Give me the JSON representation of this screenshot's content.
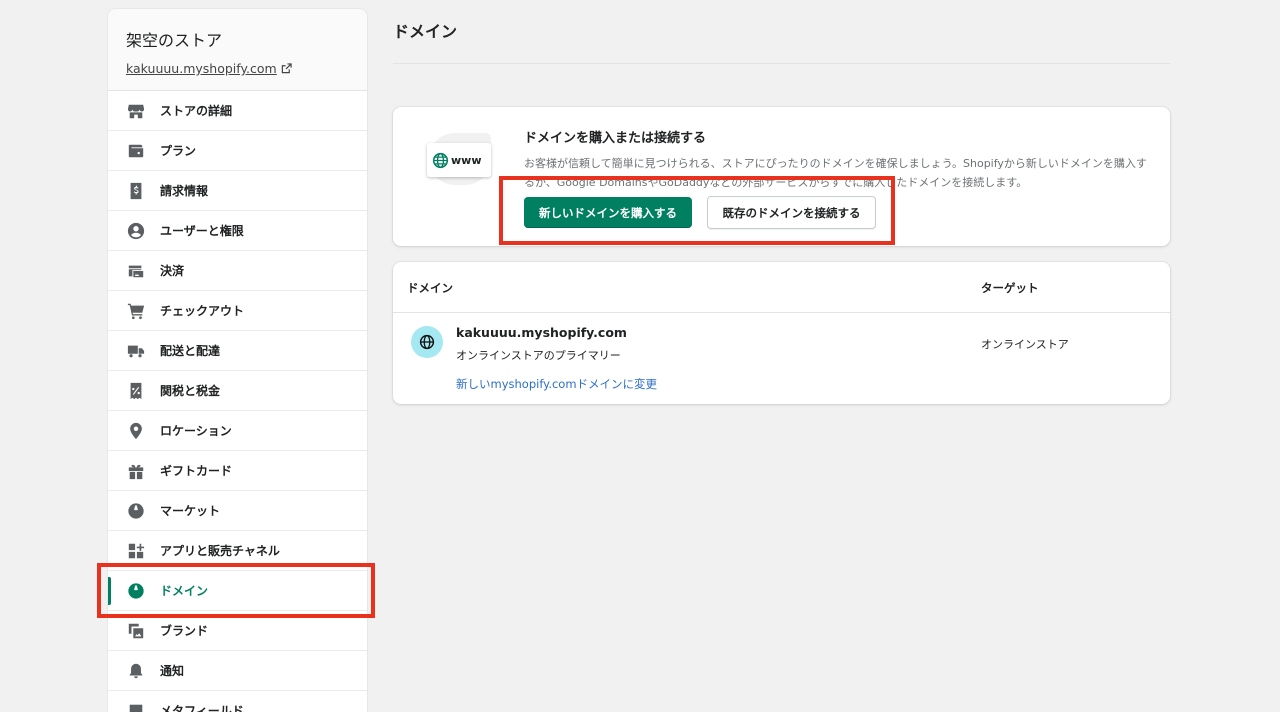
{
  "sidebar": {
    "store_name": "架空のストア",
    "store_url": "kakuuuu.myshopify.com",
    "items": [
      {
        "label": "ストアの詳細",
        "icon": "store-icon"
      },
      {
        "label": "プラン",
        "icon": "wallet-icon"
      },
      {
        "label": "請求情報",
        "icon": "billing-icon"
      },
      {
        "label": "ユーザーと権限",
        "icon": "user-icon"
      },
      {
        "label": "決済",
        "icon": "payment-card-icon"
      },
      {
        "label": "チェックアウト",
        "icon": "cart-icon"
      },
      {
        "label": "配送と配達",
        "icon": "truck-icon"
      },
      {
        "label": "関税と税金",
        "icon": "tax-receipt-icon"
      },
      {
        "label": "ロケーション",
        "icon": "location-pin-icon"
      },
      {
        "label": "ギフトカード",
        "icon": "gift-icon"
      },
      {
        "label": "マーケット",
        "icon": "globe-icon"
      },
      {
        "label": "アプリと販売チャネル",
        "icon": "apps-icon"
      },
      {
        "label": "ドメイン",
        "icon": "domain-globe-icon"
      },
      {
        "label": "ブランド",
        "icon": "brand-image-icon"
      },
      {
        "label": "通知",
        "icon": "bell-icon"
      },
      {
        "label": "メタフィールド",
        "icon": "metafield-icon"
      }
    ],
    "active_index": 12
  },
  "page": {
    "title": "ドメイン"
  },
  "connect_card": {
    "illustration_text": "www",
    "title": "ドメインを購入または接続する",
    "description": "お客様が信頼して簡単に見つけられる、ストアにぴったりのドメインを確保しましょう。Shopifyから新しいドメインを購入するか、Google DomainsやGoDaddyなどの外部サービスからすでに購入したドメインを接続します。",
    "buy_button": "新しいドメインを購入する",
    "connect_button": "既存のドメインを接続する"
  },
  "domain_table": {
    "col_domain": "ドメイン",
    "col_target": "ターゲット",
    "rows": [
      {
        "domain": "kakuuuu.myshopify.com",
        "subtitle": "オンラインストアのプライマリー",
        "change_link": "新しいmyshopify.comドメインに変更",
        "target": "オンラインストア"
      }
    ]
  },
  "colors": {
    "accent": "#008060",
    "highlight": "#e8321f",
    "link": "#2c6ecb"
  }
}
